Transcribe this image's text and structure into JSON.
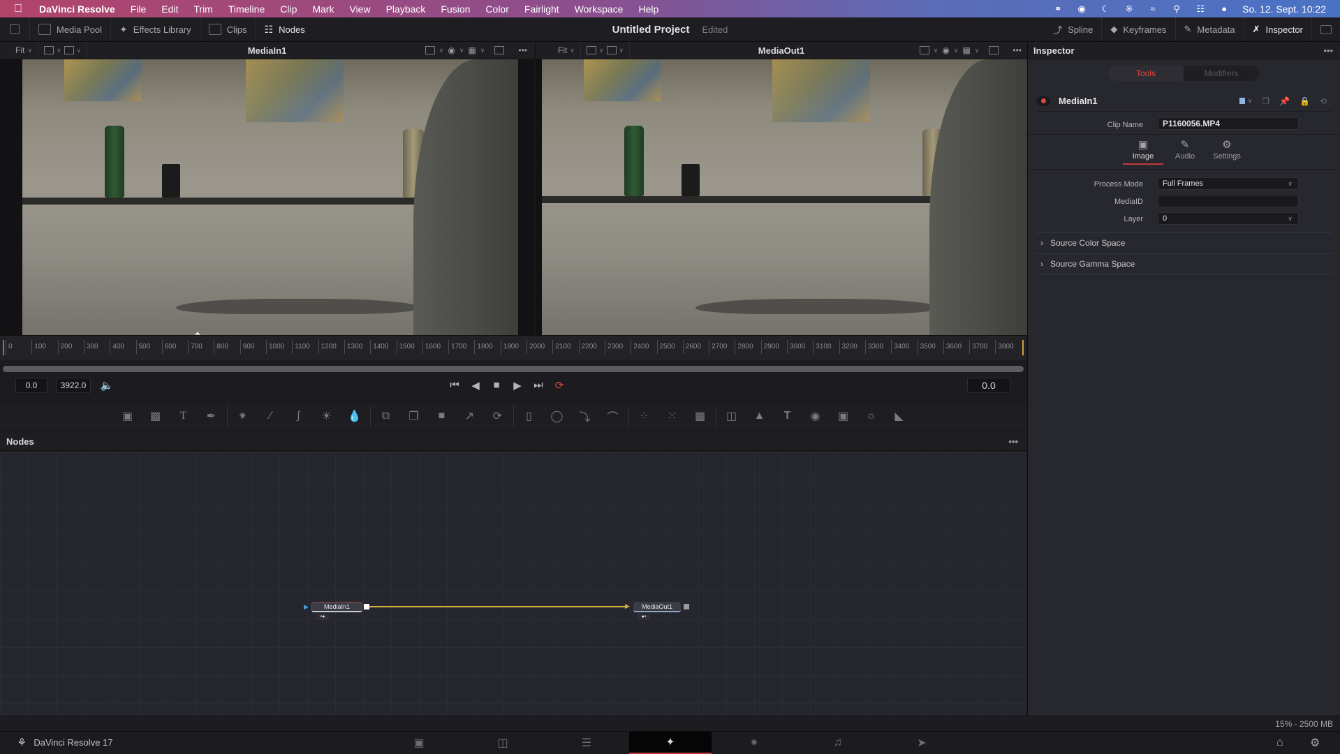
{
  "menubar": {
    "apple": "",
    "items": [
      "DaVinci Resolve",
      "File",
      "Edit",
      "Trim",
      "Timeline",
      "Clip",
      "Mark",
      "View",
      "Playback",
      "Fusion",
      "Color",
      "Fairlight",
      "Workspace",
      "Help"
    ],
    "clock": "So. 12. Sept. 10:22",
    "status_icons": [
      "creative-cloud-icon",
      "screen-record-icon",
      "moon-icon",
      "bluetooth-icon",
      "wifi-icon",
      "search-icon",
      "control-center-icon",
      "siri-icon"
    ]
  },
  "toolbar": {
    "left": [
      {
        "label": "Media Pool",
        "icon": "media-pool-icon"
      },
      {
        "label": "Effects Library",
        "icon": "effects-wand-icon"
      },
      {
        "label": "Clips",
        "icon": "clips-icon"
      },
      {
        "label": "Nodes",
        "icon": "nodes-icon"
      }
    ],
    "project_title": "Untitled Project",
    "project_status": "Edited",
    "right": [
      {
        "label": "Spline",
        "icon": "spline-icon"
      },
      {
        "label": "Keyframes",
        "icon": "keyframes-icon"
      },
      {
        "label": "Metadata",
        "icon": "metadata-icon"
      },
      {
        "label": "Inspector",
        "icon": "inspector-icon"
      }
    ]
  },
  "viewers": [
    {
      "fit": "Fit",
      "title": "MediaIn1"
    },
    {
      "fit": "Fit",
      "title": "MediaOut1"
    }
  ],
  "ruler": {
    "ticks": [
      "0",
      "100",
      "200",
      "300",
      "400",
      "500",
      "600",
      "700",
      "800",
      "900",
      "1000",
      "1100",
      "1200",
      "1300",
      "1400",
      "1500",
      "1600",
      "1700",
      "1800",
      "1900",
      "2000",
      "2100",
      "2200",
      "2300",
      "2400",
      "2500",
      "2600",
      "2700",
      "2800",
      "2900",
      "3000",
      "3100",
      "3200",
      "3300",
      "3400",
      "3500",
      "3600",
      "3700",
      "3800"
    ]
  },
  "transport": {
    "start": "0.0",
    "end": "3922.0",
    "current": "0.0"
  },
  "nodes_panel": {
    "title": "Nodes",
    "nodes": [
      {
        "name": "MediaIn1",
        "selected": true
      },
      {
        "name": "MediaOut1",
        "selected": false
      }
    ],
    "link_color": "#d5b13a"
  },
  "inspector": {
    "title": "Inspector",
    "tabs": [
      "Tools",
      "Modifiers"
    ],
    "active_tab": "Tools",
    "tool_name": "MediaIn1",
    "clip_name_label": "Clip Name",
    "clip_name": "P1160056.MP4",
    "subtabs": [
      {
        "label": "Image",
        "icon": "image-icon"
      },
      {
        "label": "Audio",
        "icon": "audio-icon"
      },
      {
        "label": "Settings",
        "icon": "settings-icon"
      }
    ],
    "active_subtab": "Image",
    "fields": [
      {
        "label": "Process Mode",
        "value": "Full Frames",
        "dropdown": true
      },
      {
        "label": "MediaID",
        "value": "",
        "dropdown": false
      },
      {
        "label": "Layer",
        "value": "0",
        "dropdown": true
      }
    ],
    "sections": [
      "Source Color Space",
      "Source Gamma Space"
    ]
  },
  "status": {
    "memory": "15% - 2500 MB"
  },
  "pagebar": {
    "app_label": "DaVinci Resolve 17",
    "pages": [
      {
        "name": "media",
        "icon": "media-page-icon"
      },
      {
        "name": "cut",
        "icon": "cut-page-icon"
      },
      {
        "name": "edit",
        "icon": "edit-page-icon"
      },
      {
        "name": "fusion",
        "icon": "fusion-page-icon",
        "active": true
      },
      {
        "name": "color",
        "icon": "color-page-icon"
      },
      {
        "name": "fairlight",
        "icon": "fairlight-page-icon"
      },
      {
        "name": "deliver",
        "icon": "deliver-page-icon"
      }
    ]
  },
  "colors": {
    "accent_red": "#c23a3f",
    "link_yellow": "#d5b13a",
    "tools_active": "#e0473f"
  }
}
